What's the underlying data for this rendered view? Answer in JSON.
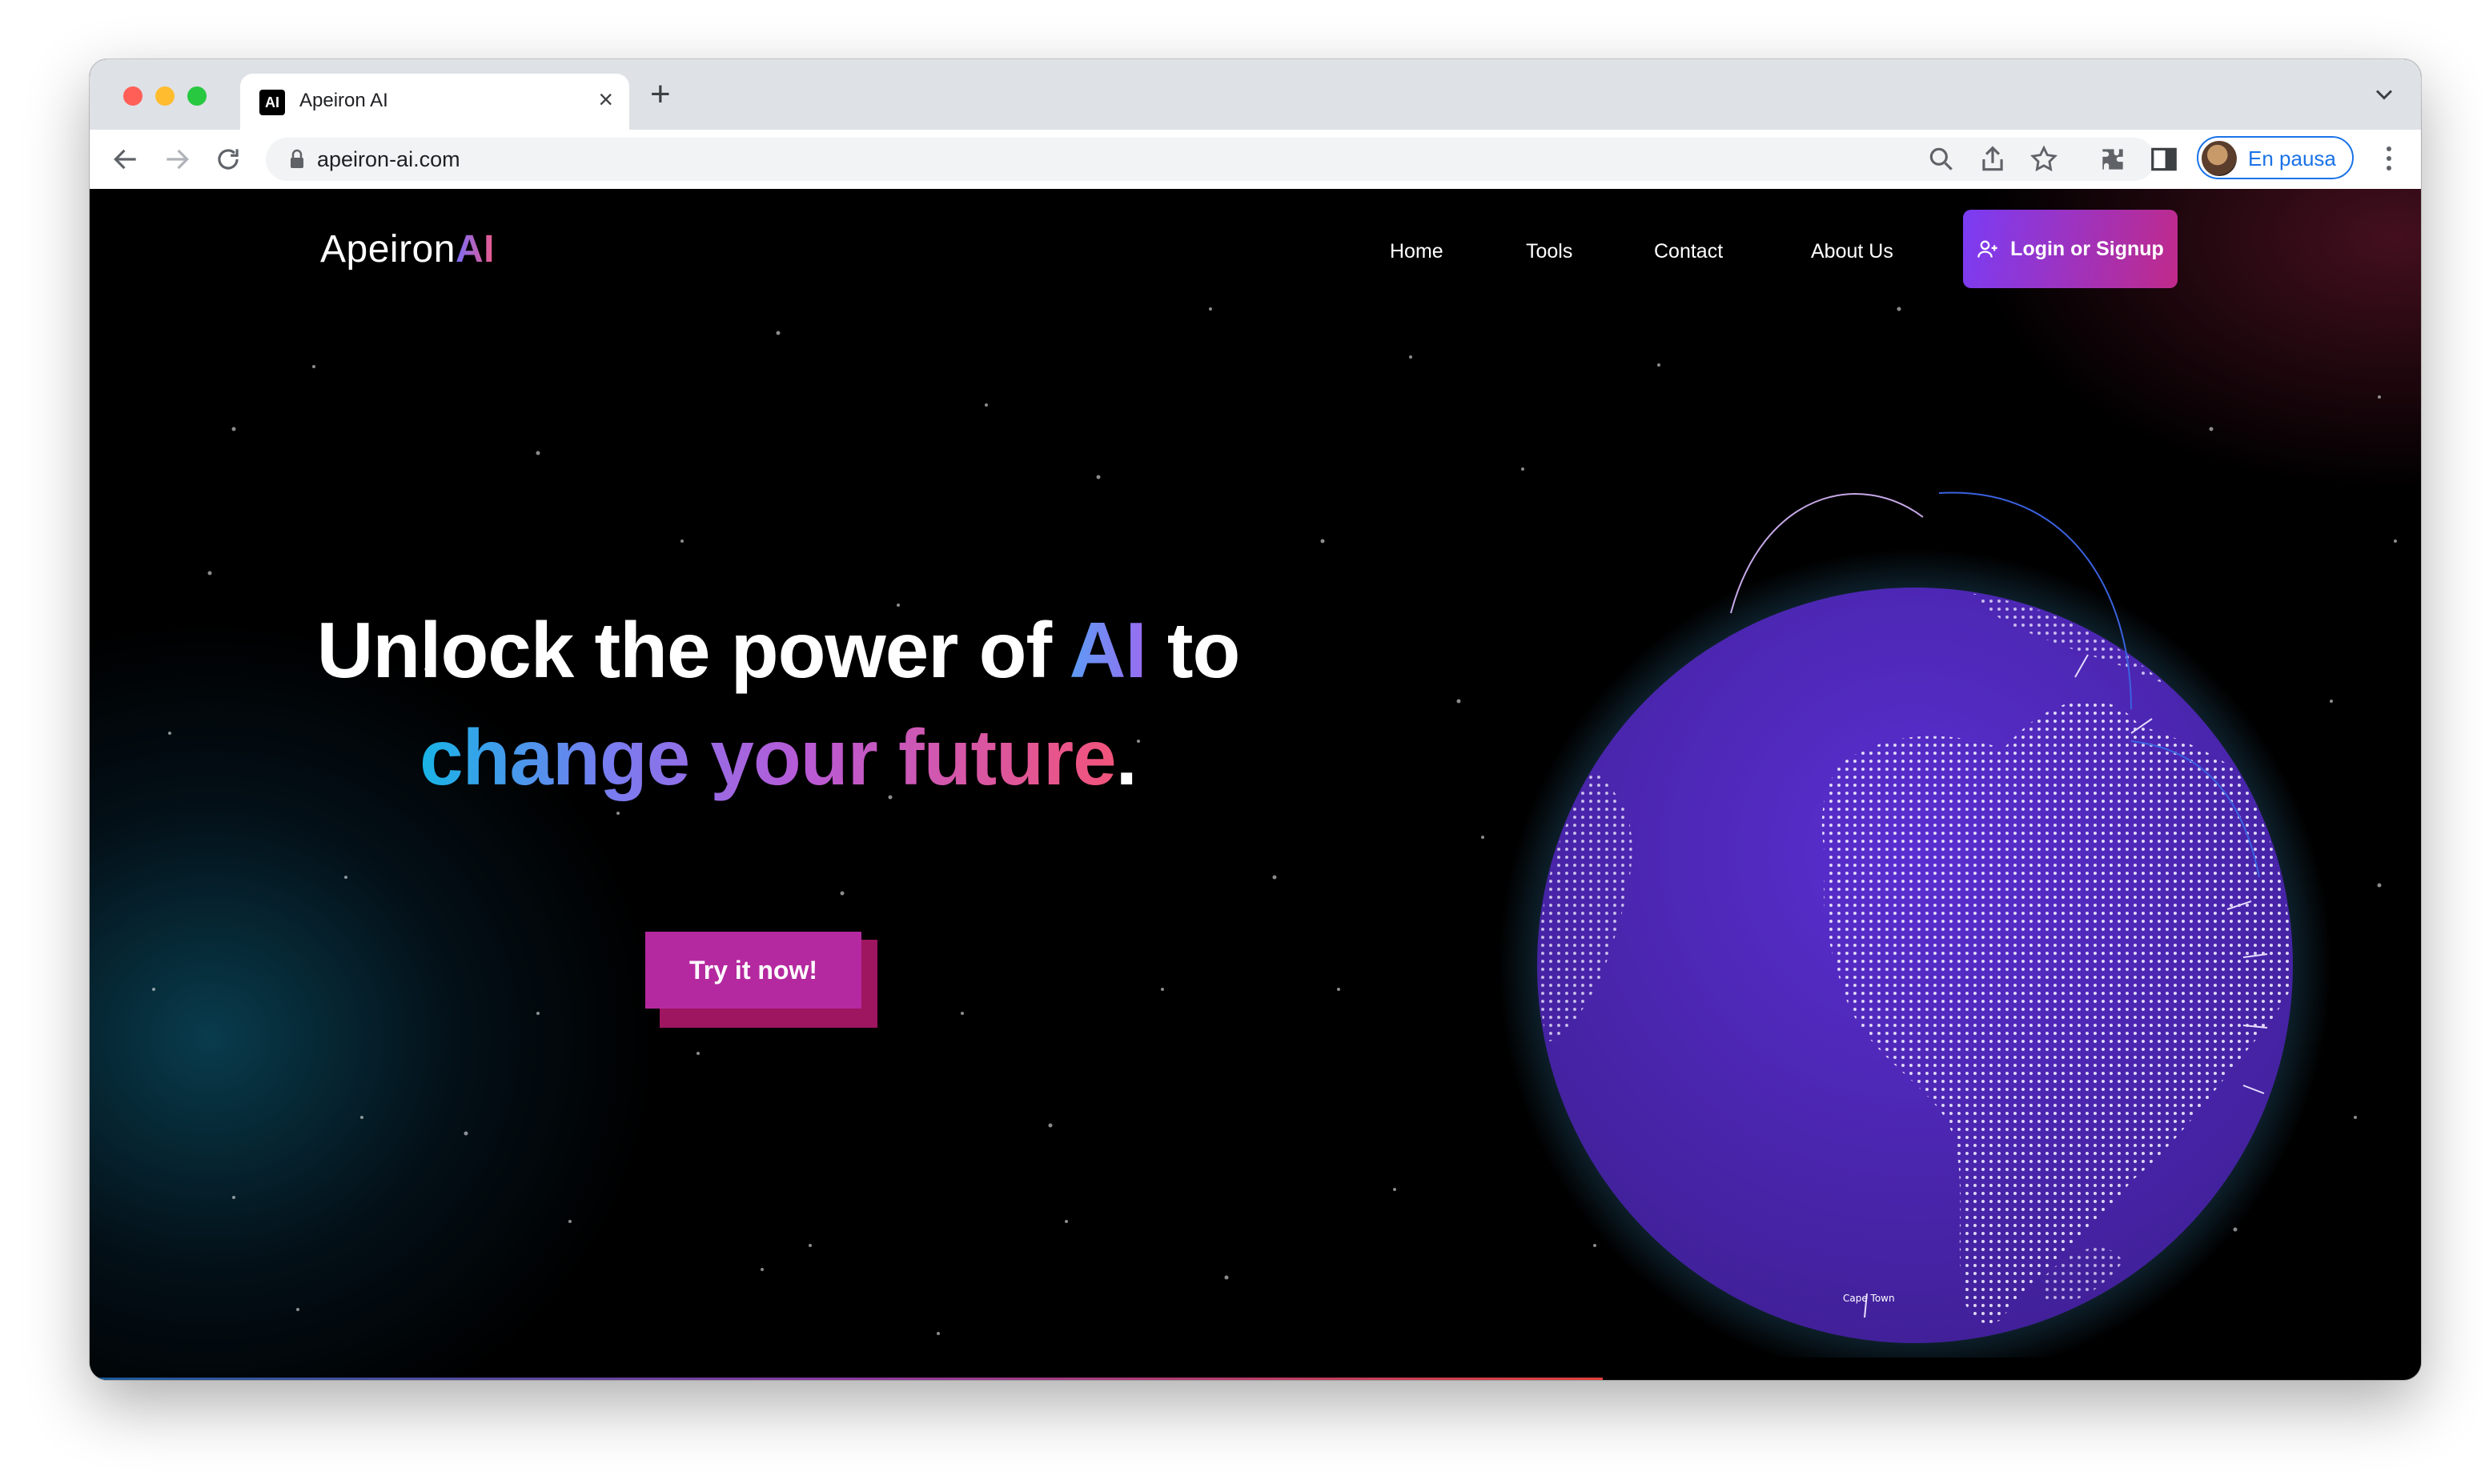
{
  "browser": {
    "tab_title": "Apeiron AI",
    "favicon_text": "AI",
    "url": "apeiron-ai.com",
    "profile_label": "En pausa"
  },
  "site": {
    "logo_text": "Apeiron",
    "logo_accent": "AI",
    "nav": [
      "Home",
      "Tools",
      "Contact",
      "About Us"
    ],
    "login_label": "Login or Signup"
  },
  "hero": {
    "line1_start": "Unlock the power of ",
    "line1_ai": "AI",
    "line1_end": " to",
    "line2_gradient": "change your future",
    "line2_end": ".",
    "cta_label": "Try it now!"
  },
  "globe": {
    "city_label": "Cape Town"
  },
  "colors": {
    "accent_purple": "#7a3cf5",
    "accent_pink": "#c02a8a",
    "globe": "#5b34c9",
    "cta": "#b529a0"
  }
}
